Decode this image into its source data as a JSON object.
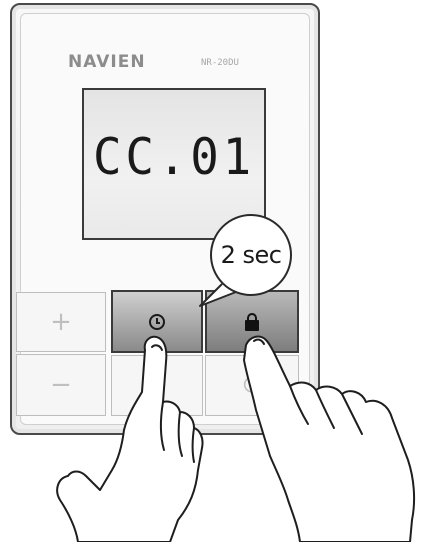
{
  "device": {
    "brand": "NAVIEN",
    "model": "NR-20DU",
    "display_value": "CC.01"
  },
  "buttons": {
    "plus": "+",
    "minus": "−",
    "power": "⏻"
  },
  "instruction": {
    "hold_duration": "2 sec"
  }
}
